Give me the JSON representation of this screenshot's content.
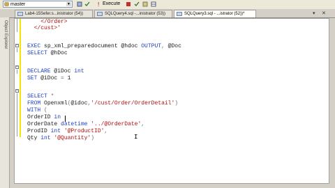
{
  "toolbar": {
    "database": "master",
    "execute_label": "Execute"
  },
  "tabs": [
    {
      "label": "Lab4-15Sefer.s...inistrator (54))"
    },
    {
      "label": "SQLQuery4.sql -...inistrator (53))"
    },
    {
      "label": "SQLQuery3.sql - ...istrator (52))*"
    }
  ],
  "sidebar": {
    "label": "Object Explorer"
  },
  "editor": {
    "lines": [
      {
        "segments": [
          {
            "t": "    </Order>",
            "c": "str"
          }
        ]
      },
      {
        "segments": [
          {
            "t": "  </cust>'",
            "c": "str"
          }
        ]
      },
      {
        "segments": [
          {
            "t": "",
            "c": ""
          }
        ]
      },
      {
        "segments": [
          {
            "t": "EXEC ",
            "c": "kw"
          },
          {
            "t": "sp_xml_preparedocument ",
            "c": ""
          },
          {
            "t": "@hdoc ",
            "c": ""
          },
          {
            "t": "OUTPUT",
            "c": "kw"
          },
          {
            "t": ", ",
            "c": "gray"
          },
          {
            "t": "@Doc",
            "c": ""
          }
        ]
      },
      {
        "segments": [
          {
            "t": "SELECT ",
            "c": "kw"
          },
          {
            "t": "@hDoc",
            "c": ""
          }
        ]
      },
      {
        "segments": [
          {
            "t": "",
            "c": ""
          }
        ]
      },
      {
        "segments": [
          {
            "t": "DECLARE ",
            "c": "kw"
          },
          {
            "t": "@iDoc ",
            "c": ""
          },
          {
            "t": "int",
            "c": "kw"
          }
        ]
      },
      {
        "segments": [
          {
            "t": "SET ",
            "c": "kw"
          },
          {
            "t": "@iDoc ",
            "c": ""
          },
          {
            "t": "= ",
            "c": "gray"
          },
          {
            "t": "1",
            "c": ""
          }
        ]
      },
      {
        "segments": [
          {
            "t": "",
            "c": ""
          }
        ]
      },
      {
        "segments": [
          {
            "t": "SELECT ",
            "c": "kw"
          },
          {
            "t": "*",
            "c": "gray"
          }
        ]
      },
      {
        "segments": [
          {
            "t": "FROM ",
            "c": "kw"
          },
          {
            "t": "Openxml",
            "c": ""
          },
          {
            "t": "(",
            "c": "gray"
          },
          {
            "t": "@idoc",
            "c": ""
          },
          {
            "t": ",",
            "c": "gray"
          },
          {
            "t": "'/cust/Order/OrderDetail'",
            "c": "str"
          },
          {
            "t": ")",
            "c": "gray"
          }
        ]
      },
      {
        "segments": [
          {
            "t": "WITH ",
            "c": "kw"
          },
          {
            "t": "(",
            "c": "gray"
          }
        ]
      },
      {
        "segments": [
          {
            "t": "OrderID ",
            "c": ""
          },
          {
            "t": "in",
            "c": "kw"
          }
        ]
      },
      {
        "segments": [
          {
            "t": "OrderDate ",
            "c": ""
          },
          {
            "t": "datetime ",
            "c": "kw"
          },
          {
            "t": "'../@OrderDate'",
            "c": "str"
          },
          {
            "t": ",",
            "c": "gray"
          }
        ]
      },
      {
        "segments": [
          {
            "t": "ProdID ",
            "c": ""
          },
          {
            "t": "int ",
            "c": "kw"
          },
          {
            "t": "'@ProductID'",
            "c": "str"
          },
          {
            "t": ",",
            "c": "gray"
          }
        ]
      },
      {
        "segments": [
          {
            "t": "Qty ",
            "c": ""
          },
          {
            "t": "int ",
            "c": "kw"
          },
          {
            "t": "'@Quantity'",
            "c": "str"
          },
          {
            "t": ")",
            "c": "gray"
          }
        ]
      }
    ]
  }
}
